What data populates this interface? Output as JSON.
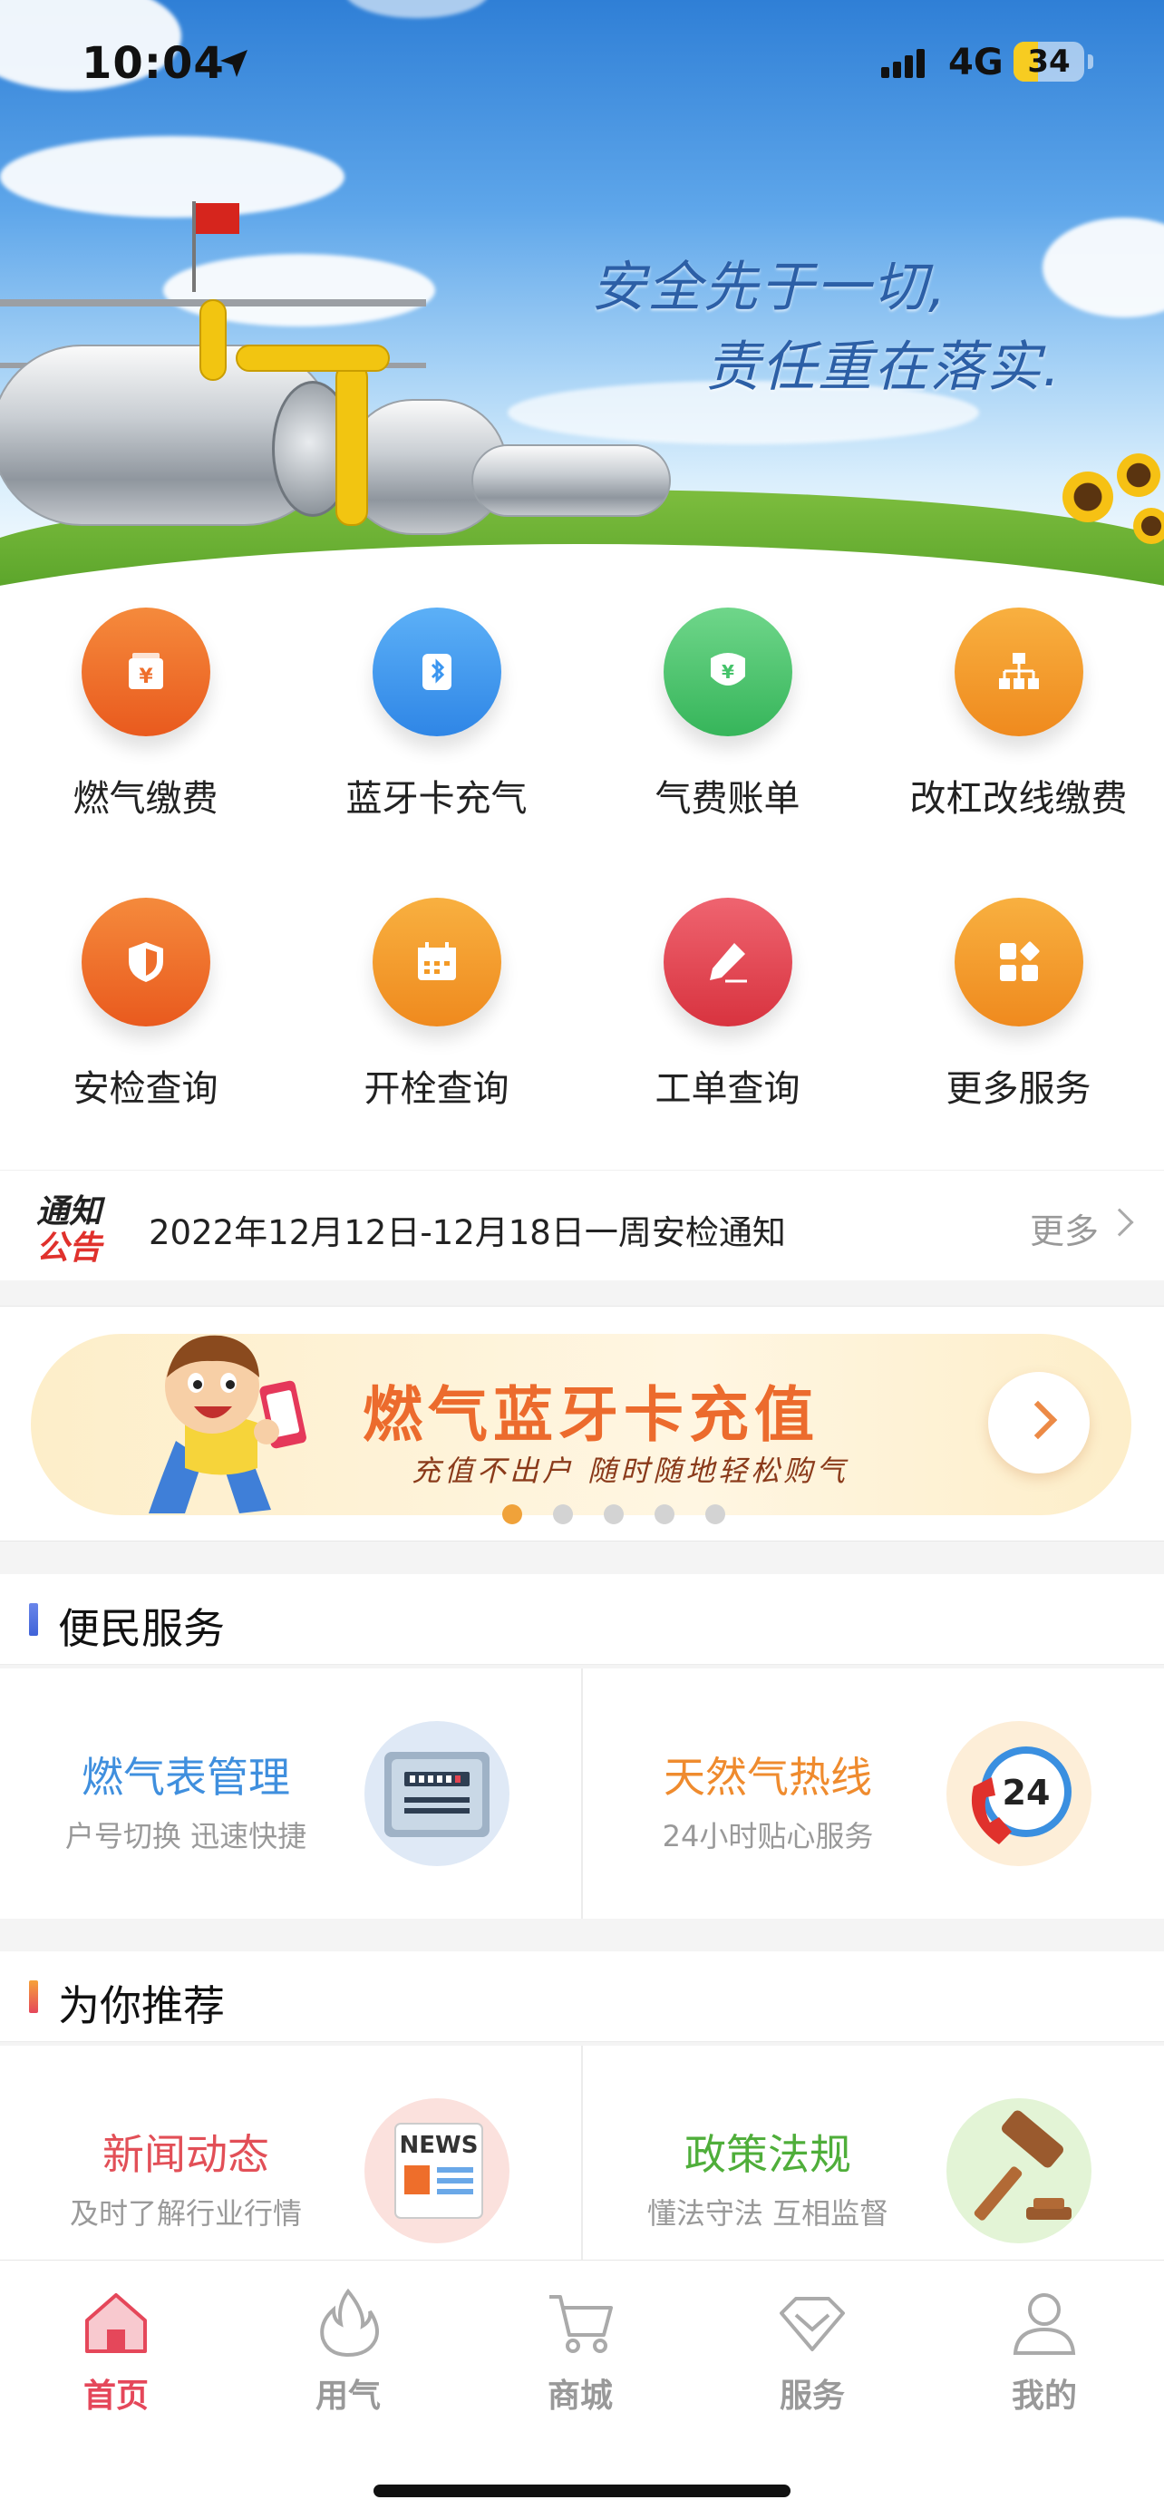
{
  "status_bar": {
    "time": "10:04",
    "network": "4G",
    "battery": "34",
    "battery_level": 0.34
  },
  "banner": {
    "slogan_line1": "安全先于一切,",
    "slogan_line2": "责任重在落实."
  },
  "grid": [
    {
      "label": "燃气缴费",
      "icon": "yen-wallet-icon",
      "color": "#ee6e2b"
    },
    {
      "label": "蓝牙卡充气",
      "icon": "bluetooth-card-icon",
      "color": "#3b96f0"
    },
    {
      "label": "气费账单",
      "icon": "yen-bill-icon",
      "color": "#45c36a"
    },
    {
      "label": "改杠改线缴费",
      "icon": "org-chart-icon",
      "color": "#f39a26"
    },
    {
      "label": "安检查询",
      "icon": "shield-icon",
      "color": "#ee6e2b"
    },
    {
      "label": "开栓查询",
      "icon": "calendar-icon",
      "color": "#f39a26"
    },
    {
      "label": "工单查询",
      "icon": "pencil-icon",
      "color": "#e34552"
    },
    {
      "label": "更多服务",
      "icon": "grid-apps-icon",
      "color": "#f39a26"
    }
  ],
  "notice": {
    "logo_line1": "通知",
    "logo_line2": "公告",
    "text": "2022年12月12日-12月18日一周安检通知",
    "more": "更多"
  },
  "promo": {
    "title": "燃气蓝牙卡充值",
    "subtitle": "充值不出户 随时随地轻松购气",
    "slides": 5,
    "active_slide": 1
  },
  "section_services": {
    "title": "便民服务",
    "cards": [
      {
        "title": "燃气表管理",
        "sub": "户号切换 迅速快捷",
        "color": "#3f8fde",
        "icon": "gas-meter-icon"
      },
      {
        "title": "天然气热线",
        "sub": "24小时贴心服务",
        "color": "#ef8b2e",
        "icon": "hotline-24-icon"
      }
    ]
  },
  "section_recommend": {
    "title": "为你推荐",
    "cards": [
      {
        "title": "新闻动态",
        "sub": "及时了解行业行情",
        "color": "#e24f57",
        "icon": "news-icon",
        "badge": "NEWS"
      },
      {
        "title": "政策法规",
        "sub": "懂法守法 互相监督",
        "color": "#4fae3a",
        "icon": "gavel-icon"
      }
    ]
  },
  "hotline_badge": "24",
  "tabs": [
    {
      "label": "首页",
      "icon": "home-icon",
      "active": true
    },
    {
      "label": "用气",
      "icon": "flame-icon",
      "active": false
    },
    {
      "label": "商城",
      "icon": "cart-icon",
      "active": false
    },
    {
      "label": "服务",
      "icon": "diamond-icon",
      "active": false
    },
    {
      "label": "我的",
      "icon": "user-icon",
      "active": false
    }
  ]
}
